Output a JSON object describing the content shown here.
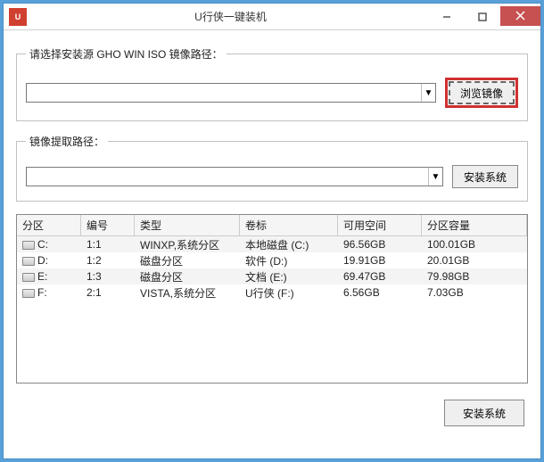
{
  "window": {
    "title": "U行侠一键装机",
    "icon_label": "U"
  },
  "source_group": {
    "legend": "请选择安装源 GHO WIN ISO 镜像路径：",
    "combo_value": "",
    "browse_button": "浏览镜像"
  },
  "extract_group": {
    "legend": "镜像提取路径：",
    "combo_value": "",
    "install_button": "安装系统"
  },
  "table": {
    "headers": [
      "分区",
      "编号",
      "类型",
      "卷标",
      "可用空间",
      "分区容量"
    ],
    "rows": [
      {
        "drive": "C:",
        "num": "1:1",
        "type": "WINXP,系统分区",
        "label": "本地磁盘 (C:)",
        "free": "96.56GB",
        "size": "100.01GB"
      },
      {
        "drive": "D:",
        "num": "1:2",
        "type": "磁盘分区",
        "label": "软件 (D:)",
        "free": "19.91GB",
        "size": "20.01GB"
      },
      {
        "drive": "E:",
        "num": "1:3",
        "type": "磁盘分区",
        "label": "文档 (E:)",
        "free": "69.47GB",
        "size": "79.98GB"
      },
      {
        "drive": "F:",
        "num": "2:1",
        "type": "VISTA,系统分区",
        "label": "U行侠 (F:)",
        "free": "6.56GB",
        "size": "7.03GB"
      }
    ]
  },
  "bottom_install_button": "安装系统"
}
